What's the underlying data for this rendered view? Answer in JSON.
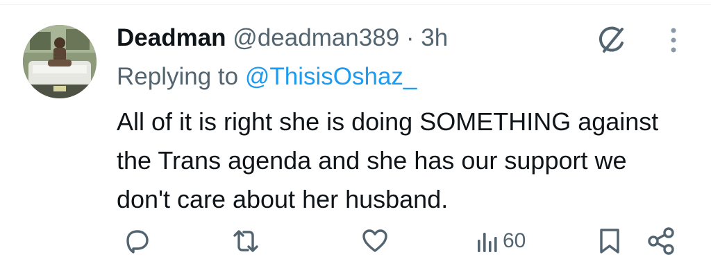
{
  "tweet": {
    "display_name": "Deadman",
    "handle": "@deadman389",
    "separator": "·",
    "time": "3h",
    "replying_prefix": "Replying to",
    "replying_to": "@ThisisOshaz_",
    "text": "All of it is right she is doing SOMETHING against the Trans agenda and she has our support we don't care about her husband."
  },
  "actions": {
    "views_count": "60"
  },
  "icons": {
    "reply": "reply-icon",
    "retweet": "retweet-icon",
    "like": "heart-icon",
    "views": "views-icon",
    "bookmark": "bookmark-icon",
    "share": "share-icon",
    "grok": "grok-icon",
    "more": "more-vertical-icon"
  },
  "colors": {
    "text": "#0f1419",
    "secondary": "#536471",
    "link": "#1d9bf0"
  }
}
